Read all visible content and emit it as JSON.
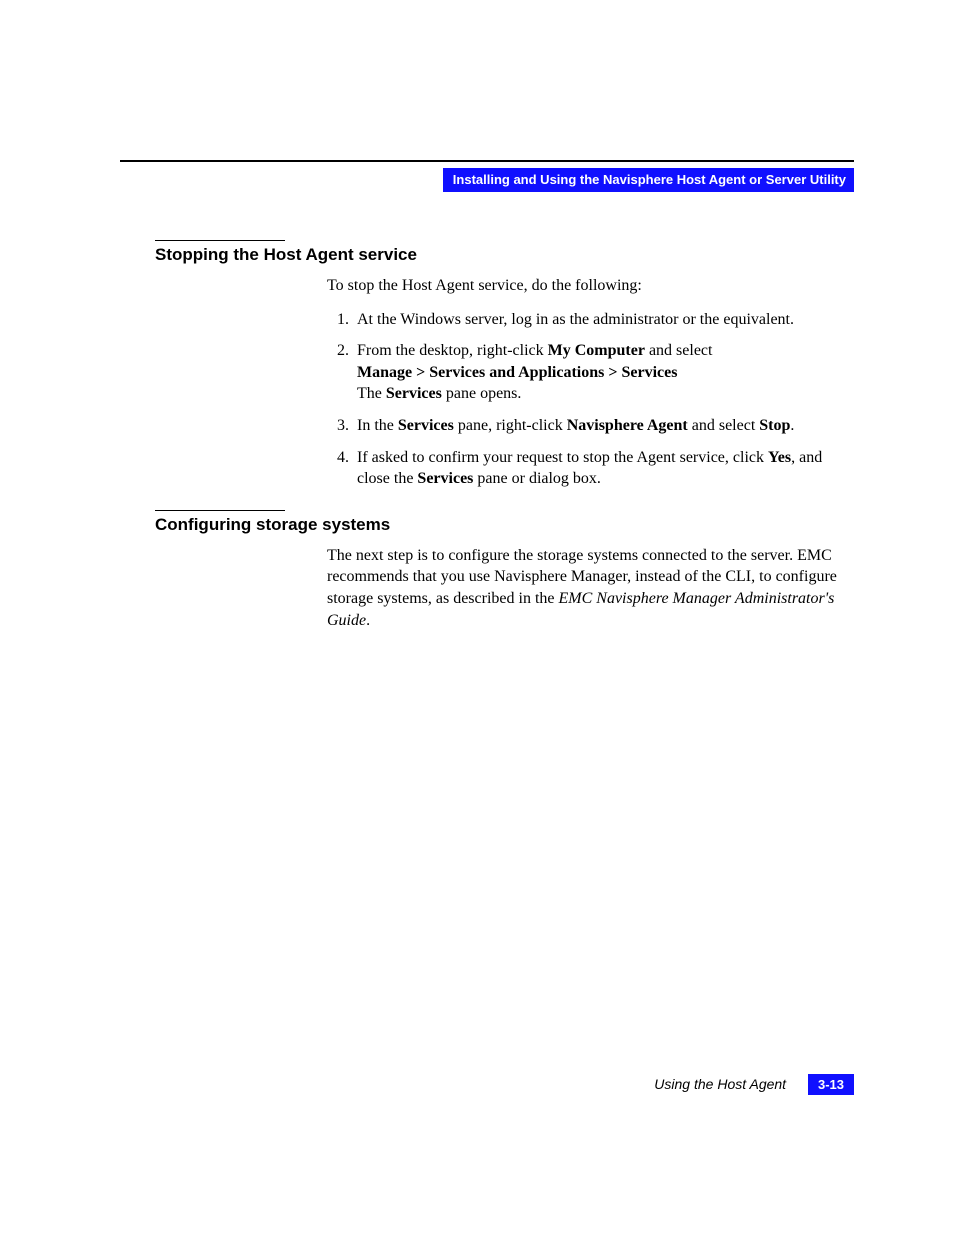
{
  "header": {
    "chapter_bar": "Installing and Using the Navisphere Host Agent or Server Utility"
  },
  "sections": [
    {
      "title": "Stopping the Host Agent service",
      "intro": "To stop the Host Agent service, do the following:",
      "steps_html": [
        "At the Windows server, log in as the administrator or the equivalent.",
        "From the desktop, right-click <span class=\"b\">My Computer</span> and select<br><span class=\"b\">Manage &gt; Services and Applications &gt; Services</span><br>The <span class=\"b\">Services</span> pane opens.",
        "In the <span class=\"b\">Services</span> pane, right-click <span class=\"b\">Navisphere Agent</span> and select <span class=\"b\">Stop</span>.",
        "If asked to confirm your request to stop the Agent service, click <span class=\"b\">Yes</span>, and close the <span class=\"b\">Services</span> pane or dialog box."
      ]
    },
    {
      "title": "Configuring storage systems",
      "body_html": "The next step is to configure the storage systems connected to the server. EMC recommends that you use Navisphere Manager, instead of the CLI, to configure storage systems, as described in the <span class=\"i\">EMC Navisphere Manager Administrator's Guide</span>."
    }
  ],
  "footer": {
    "label": "Using the Host Agent",
    "page": "3-13"
  }
}
